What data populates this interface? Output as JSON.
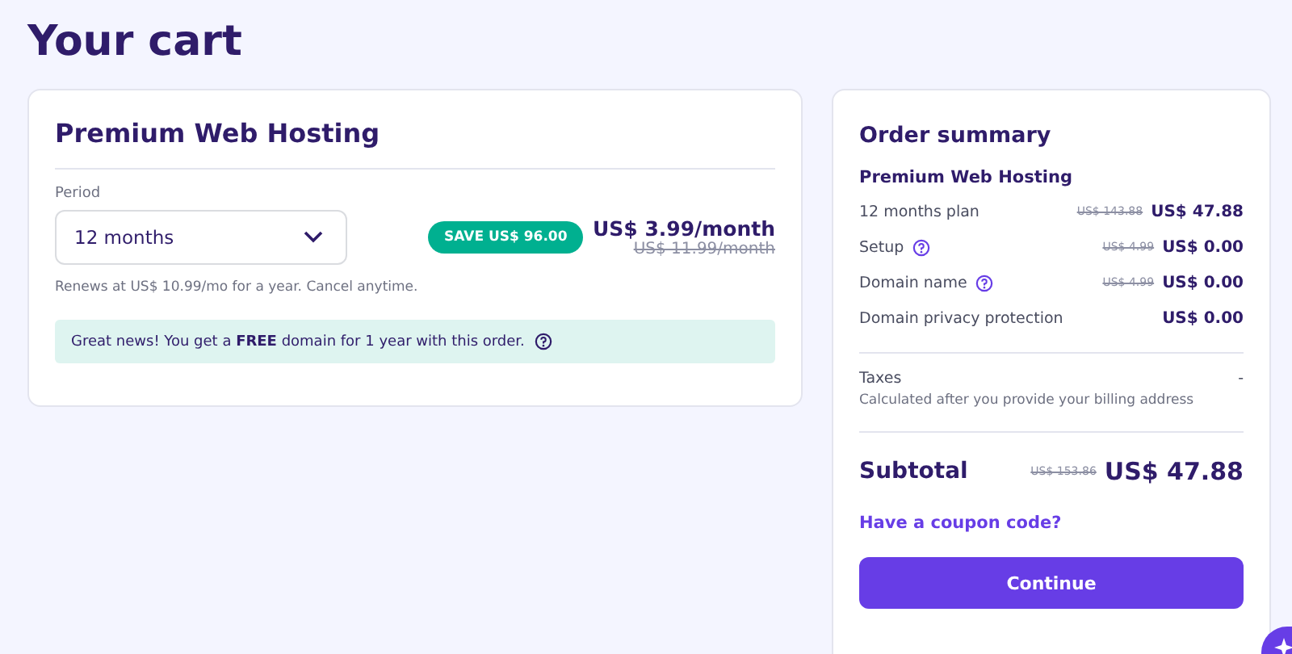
{
  "page_title": "Your cart",
  "product": {
    "title": "Premium Web Hosting",
    "period_label": "Period",
    "period_value": "12 months",
    "save_badge": "SAVE US$ 96.00",
    "price": "US$ 3.99/month",
    "old_price": "US$ 11.99/month",
    "renew_note": "Renews at US$ 10.99/mo for a year. Cancel anytime.",
    "promo": "Great news! You get a **FREE** domain for 1 year with this order."
  },
  "summary": {
    "title": "Order summary",
    "product": "Premium Web Hosting",
    "items": [
      {
        "label": "12 months plan",
        "help": false,
        "old_price": "US$ 143.88",
        "price": "US$ 47.88"
      },
      {
        "label": "Setup",
        "help": true,
        "old_price": "US$ 4.99",
        "price": "US$ 0.00"
      },
      {
        "label": "Domain name",
        "help": true,
        "old_price": "US$ 4.99",
        "price": "US$ 0.00"
      },
      {
        "label": "Domain privacy protection",
        "help": false,
        "price": "US$ 0.00"
      }
    ],
    "taxes_label": "Taxes",
    "taxes_value": "-",
    "taxes_note": "Calculated after you provide your billing address",
    "subtotal_label": "Subtotal",
    "subtotal_old": "US$ 153.86",
    "subtotal": "US$ 47.88",
    "coupon_link": "Have a coupon code?",
    "continue_button": "Continue"
  }
}
